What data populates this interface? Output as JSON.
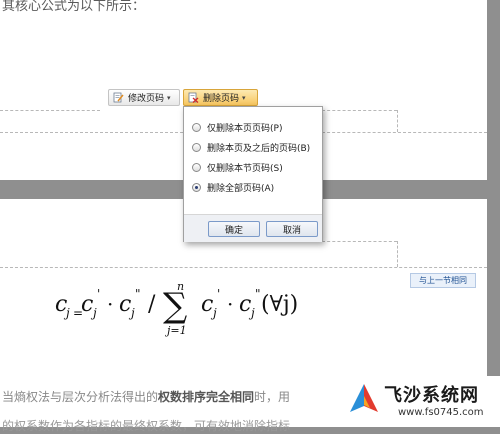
{
  "document": {
    "top_text": "其核心公式为以下所示：",
    "bottom_text_plain_1": "当熵权法与层次分析法得出的",
    "bottom_text_bold": "权数排序完全相同",
    "bottom_text_plain_2": "时，用",
    "bottom_text_line2": "的权系数作为各指标的最终权系数，可有效地消除指标",
    "link_to_previous": "与上一节相同"
  },
  "toolbar": {
    "modify_label": "修改页码",
    "delete_label": "删除页码"
  },
  "dropdown": {
    "options": [
      {
        "label": "仅删除本页页码(P)",
        "checked": false
      },
      {
        "label": "删除本页及之后的页码(B)",
        "checked": false
      },
      {
        "label": "仅删除本节页码(S)",
        "checked": false
      },
      {
        "label": "删除全部页码(A)",
        "checked": true
      }
    ],
    "ok_label": "确定",
    "cancel_label": "取消"
  },
  "formula": {
    "lhs_c": "c",
    "lhs_sub": "j",
    "eq": "=",
    "c1": "c",
    "c1_sub": "j",
    "prime": "'",
    "dot": "·",
    "c2": "c",
    "c2_sub": "j",
    "dprime": "\"",
    "slash": "/",
    "sum": "∑",
    "sum_top": "n",
    "sum_bottom": "j=1",
    "c3": "c",
    "c3_sub": "j",
    "c4": "c",
    "c4_sub": "j",
    "tail": "(∀j)"
  },
  "watermark": {
    "title": "飞沙系统网",
    "url": "www.fs0745.com"
  },
  "colors": {
    "accent": "#f7c65f",
    "link": "#1d4f91"
  }
}
